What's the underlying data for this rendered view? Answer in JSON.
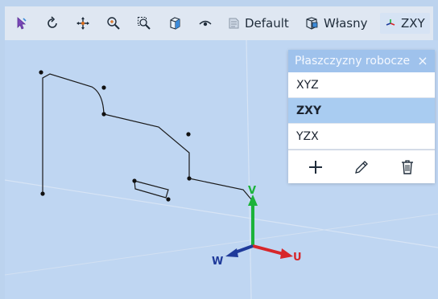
{
  "toolbar": {
    "icons": [
      "select-icon",
      "rotate-icon",
      "pan-icon",
      "zoom-icon",
      "zoom-window-icon",
      "view-cube-icon",
      "visibility-icon"
    ],
    "view_default_label": "Default",
    "view_custom_label": "Własny",
    "plane_label": "ZXY",
    "accent": "#dfe7f2"
  },
  "panel": {
    "title": "Płaszczyzny robocze",
    "close_icon": "×",
    "items": [
      {
        "label": "XYZ",
        "selected": false
      },
      {
        "label": "ZXY",
        "selected": true
      },
      {
        "label": "YZX",
        "selected": false
      }
    ],
    "actions": [
      "add-icon",
      "edit-icon",
      "delete-icon"
    ],
    "colors": {
      "header": "#9fc2ec",
      "selected": "#a9ccf1"
    }
  },
  "axes": {
    "v_label": "V",
    "u_label": "U",
    "w_label": "W",
    "colors": {
      "v": "#1bb33a",
      "u": "#d7262a",
      "w": "#1f3a9a"
    }
  },
  "viewport": {
    "background": "#bfd6f2"
  }
}
